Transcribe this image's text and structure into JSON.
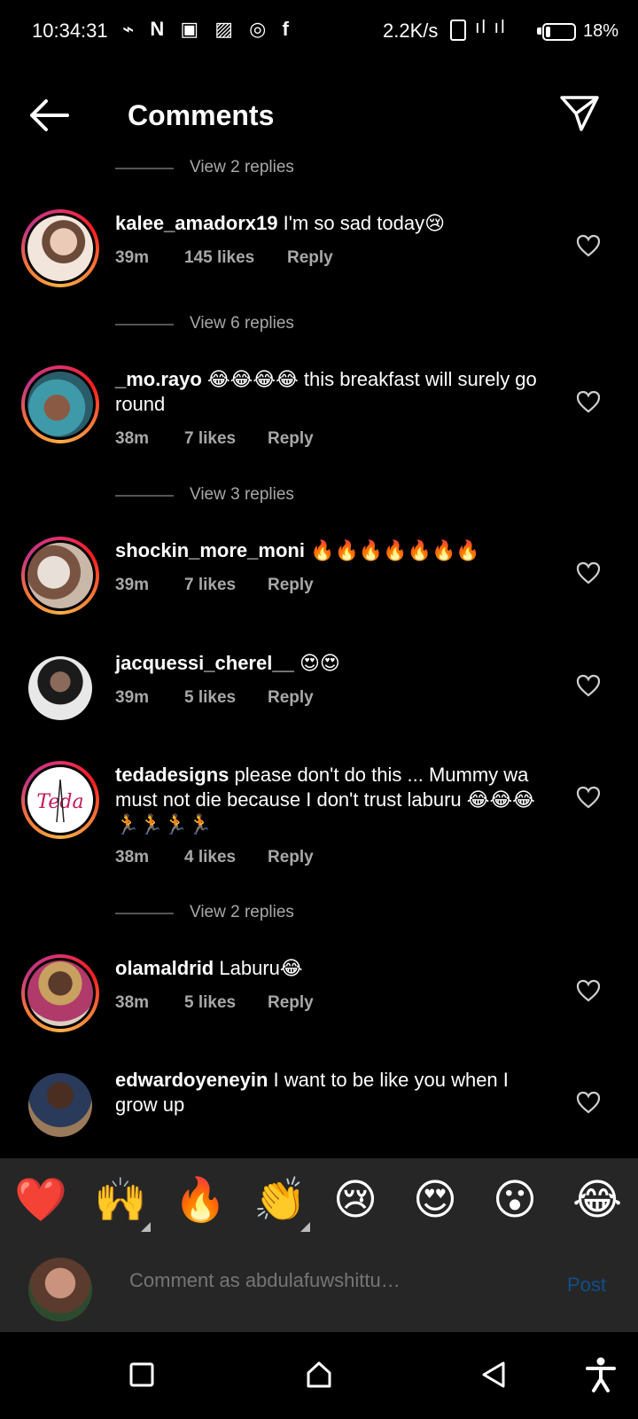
{
  "status_bar": {
    "time": "10:34:31",
    "notif_icons": "⌁ N ▣ ▨ ◎ f",
    "speed": "2.2K/s",
    "signal": "ıl ıl",
    "battery_percent": "18%",
    "battery_level": 0.18
  },
  "header": {
    "title": "Comments"
  },
  "comments": [
    {
      "view_replies": "View 2 replies",
      "username": "kalee_amadorx19",
      "text": "I'm so sad today😢",
      "time": "39m",
      "likes": "145 likes",
      "reply": "Reply",
      "has_story_ring": true
    },
    {
      "view_replies": "View 6 replies",
      "username": "_mo.rayo",
      "text": "😂😂😂😂 this breakfast will surely go round",
      "time": "38m",
      "likes": "7 likes",
      "reply": "Reply",
      "has_story_ring": true
    },
    {
      "view_replies": "View 3 replies",
      "username": "shockin_more_moni",
      "text": "🔥🔥🔥🔥🔥🔥🔥",
      "time": "39m",
      "likes": "7 likes",
      "reply": "Reply",
      "has_story_ring": true
    },
    {
      "username": "jacquessi_cherel__",
      "text": "😍😍",
      "time": "39m",
      "likes": "5 likes",
      "reply": "Reply",
      "has_story_ring": false
    },
    {
      "username": "tedadesigns",
      "text": "please don't do this ... Mummy wa must not die because I don't trust laburu 😂😂😂🏃🏃🏃🏃",
      "time": "38m",
      "likes": "4 likes",
      "reply": "Reply",
      "has_story_ring": true,
      "avatar_text": "Teda"
    },
    {
      "view_replies": "View 2 replies",
      "username": "olamaldrid",
      "text": "Laburu😂",
      "time": "38m",
      "likes": "5 likes",
      "reply": "Reply",
      "has_story_ring": true
    },
    {
      "username": "edwardoyeneyin",
      "text": "I want to be like you when I grow up",
      "has_story_ring": false
    }
  ],
  "emoji_bar": [
    "❤️",
    "🙌",
    "🔥",
    "👏",
    "😢",
    "😍",
    "😮",
    "😂"
  ],
  "comment_input": {
    "placeholder": "Comment as abdulafuwshittu…",
    "post_label": "Post"
  },
  "colors": {
    "background": "#000000",
    "panel": "#262626",
    "muted_text": "#a8a8a8",
    "post_button": "#0f4f8a"
  }
}
